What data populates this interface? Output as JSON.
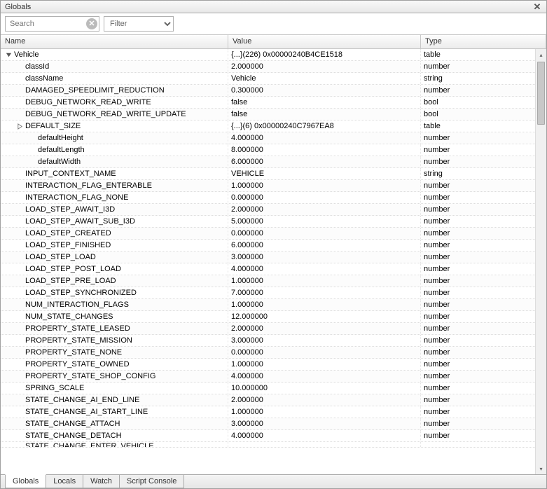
{
  "panel": {
    "title": "Globals"
  },
  "toolbar": {
    "search_placeholder": "Search",
    "filter_placeholder": "Filter"
  },
  "columns": {
    "name": "Name",
    "value": "Value",
    "type": "Type"
  },
  "tree": [
    {
      "indent": 0,
      "expander": "open",
      "name": "Vehicle",
      "value": "{...}(226) 0x00000240B4CE1518",
      "type": "table"
    },
    {
      "indent": 1,
      "name": "classId",
      "value": "2.000000",
      "type": "number"
    },
    {
      "indent": 1,
      "name": "className",
      "value": "Vehicle",
      "type": "string"
    },
    {
      "indent": 1,
      "name": "DAMAGED_SPEEDLIMIT_REDUCTION",
      "value": "0.300000",
      "type": "number"
    },
    {
      "indent": 1,
      "name": "DEBUG_NETWORK_READ_WRITE",
      "value": "false",
      "type": "bool"
    },
    {
      "indent": 1,
      "name": "DEBUG_NETWORK_READ_WRITE_UPDATE",
      "value": "false",
      "type": "bool"
    },
    {
      "indent": 1,
      "expander": "closed",
      "name": "DEFAULT_SIZE",
      "value": "{...}(6) 0x00000240C7967EA8",
      "type": "table"
    },
    {
      "indent": 2,
      "name": "defaultHeight",
      "value": "4.000000",
      "type": "number"
    },
    {
      "indent": 2,
      "name": "defaultLength",
      "value": "8.000000",
      "type": "number"
    },
    {
      "indent": 2,
      "name": "defaultWidth",
      "value": "6.000000",
      "type": "number"
    },
    {
      "indent": 1,
      "name": "INPUT_CONTEXT_NAME",
      "value": "VEHICLE",
      "type": "string"
    },
    {
      "indent": 1,
      "name": "INTERACTION_FLAG_ENTERABLE",
      "value": "1.000000",
      "type": "number"
    },
    {
      "indent": 1,
      "name": "INTERACTION_FLAG_NONE",
      "value": "0.000000",
      "type": "number"
    },
    {
      "indent": 1,
      "name": "LOAD_STEP_AWAIT_I3D",
      "value": "2.000000",
      "type": "number"
    },
    {
      "indent": 1,
      "name": "LOAD_STEP_AWAIT_SUB_I3D",
      "value": "5.000000",
      "type": "number"
    },
    {
      "indent": 1,
      "name": "LOAD_STEP_CREATED",
      "value": "0.000000",
      "type": "number"
    },
    {
      "indent": 1,
      "name": "LOAD_STEP_FINISHED",
      "value": "6.000000",
      "type": "number"
    },
    {
      "indent": 1,
      "name": "LOAD_STEP_LOAD",
      "value": "3.000000",
      "type": "number"
    },
    {
      "indent": 1,
      "name": "LOAD_STEP_POST_LOAD",
      "value": "4.000000",
      "type": "number"
    },
    {
      "indent": 1,
      "name": "LOAD_STEP_PRE_LOAD",
      "value": "1.000000",
      "type": "number"
    },
    {
      "indent": 1,
      "name": "LOAD_STEP_SYNCHRONIZED",
      "value": "7.000000",
      "type": "number"
    },
    {
      "indent": 1,
      "name": "NUM_INTERACTION_FLAGS",
      "value": "1.000000",
      "type": "number"
    },
    {
      "indent": 1,
      "name": "NUM_STATE_CHANGES",
      "value": "12.000000",
      "type": "number"
    },
    {
      "indent": 1,
      "name": "PROPERTY_STATE_LEASED",
      "value": "2.000000",
      "type": "number"
    },
    {
      "indent": 1,
      "name": "PROPERTY_STATE_MISSION",
      "value": "3.000000",
      "type": "number"
    },
    {
      "indent": 1,
      "name": "PROPERTY_STATE_NONE",
      "value": "0.000000",
      "type": "number"
    },
    {
      "indent": 1,
      "name": "PROPERTY_STATE_OWNED",
      "value": "1.000000",
      "type": "number"
    },
    {
      "indent": 1,
      "name": "PROPERTY_STATE_SHOP_CONFIG",
      "value": "4.000000",
      "type": "number"
    },
    {
      "indent": 1,
      "name": "SPRING_SCALE",
      "value": "10.000000",
      "type": "number"
    },
    {
      "indent": 1,
      "name": "STATE_CHANGE_AI_END_LINE",
      "value": "2.000000",
      "type": "number"
    },
    {
      "indent": 1,
      "name": "STATE_CHANGE_AI_START_LINE",
      "value": "1.000000",
      "type": "number"
    },
    {
      "indent": 1,
      "name": "STATE_CHANGE_ATTACH",
      "value": "3.000000",
      "type": "number"
    },
    {
      "indent": 1,
      "name": "STATE_CHANGE_DETACH",
      "value": "4.000000",
      "type": "number"
    }
  ],
  "cutoff": {
    "name": "STATE_CHANGE_ENTER_VEHICLE",
    "value": "",
    "type": ""
  },
  "tabs": [
    {
      "label": "Globals",
      "active": true
    },
    {
      "label": "Locals",
      "active": false
    },
    {
      "label": "Watch",
      "active": false
    },
    {
      "label": "Script Console",
      "active": false
    }
  ]
}
